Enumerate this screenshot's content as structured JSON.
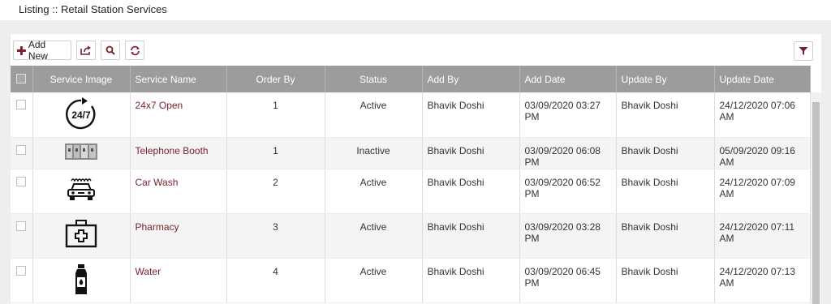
{
  "header": {
    "title": "Listing :: Retail Station Services"
  },
  "toolbar": {
    "add_new_label": "Add New"
  },
  "colors": {
    "accent": "#7a1f2b",
    "header_bg": "#9c9c9c"
  },
  "table": {
    "columns": [
      "Service Image",
      "Service Name",
      "Order By",
      "Status",
      "Add By",
      "Add Date",
      "Update By",
      "Update Date"
    ],
    "rows": [
      {
        "icon": "24x7-icon",
        "name": "24x7 Open",
        "order": "1",
        "status": "Active",
        "add_by": "Bhavik Doshi",
        "add_date": "03/09/2020 03:27 PM",
        "update_by": "Bhavik Doshi",
        "update_date": "24/12/2020 07:06 AM"
      },
      {
        "icon": "telephone-booth-image",
        "name": "Telephone Booth",
        "order": "1",
        "status": "Inactive",
        "add_by": "Bhavik Doshi",
        "add_date": "03/09/2020 06:08 PM",
        "update_by": "Bhavik Doshi",
        "update_date": "05/09/2020 09:16 AM"
      },
      {
        "icon": "car-wash-icon",
        "name": "Car Wash",
        "order": "2",
        "status": "Active",
        "add_by": "Bhavik Doshi",
        "add_date": "03/09/2020 06:52 PM",
        "update_by": "Bhavik Doshi",
        "update_date": "24/12/2020 07:09 AM"
      },
      {
        "icon": "first-aid-kit-icon",
        "name": "Pharmacy",
        "order": "3",
        "status": "Active",
        "add_by": "Bhavik Doshi",
        "add_date": "03/09/2020 03:28 PM",
        "update_by": "Bhavik Doshi",
        "update_date": "24/12/2020 07:11 AM"
      },
      {
        "icon": "water-bottle-icon",
        "name": "Water",
        "order": "4",
        "status": "Active",
        "add_by": "Bhavik Doshi",
        "add_date": "03/09/2020 06:45 PM",
        "update_by": "Bhavik Doshi",
        "update_date": "24/12/2020 07:13 AM"
      }
    ]
  }
}
